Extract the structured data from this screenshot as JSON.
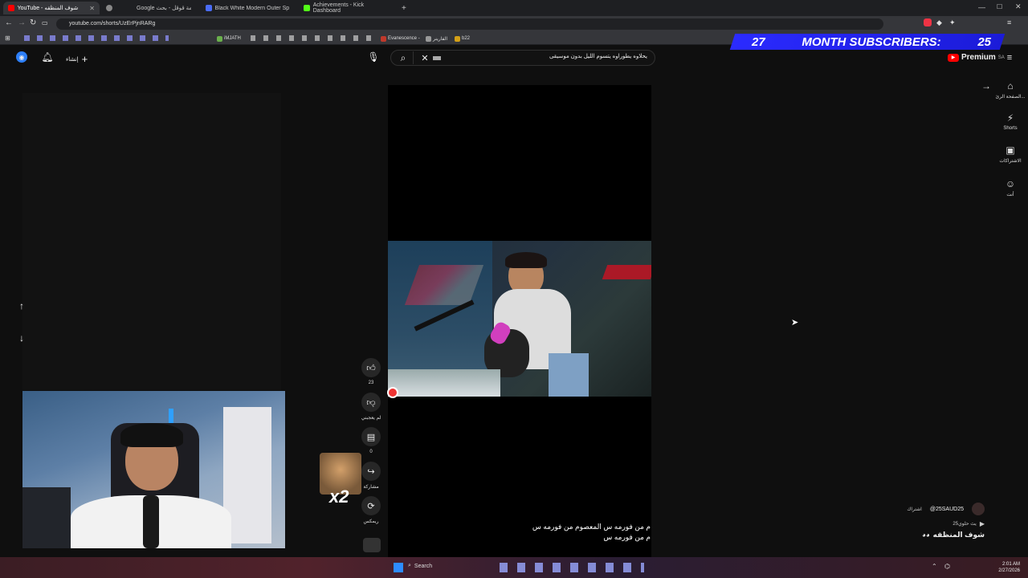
{
  "browser": {
    "tabs": [
      {
        "title": "YouTube - شوف المنظقه",
        "active": true
      },
      {
        "title": "",
        "active": false
      },
      {
        "title": "Google ترجمة قوقل - بحث",
        "active": false
      },
      {
        "title": "Black White Modern Outer Space Pr...",
        "active": false
      },
      {
        "title": "Achievements - Kick Dashboard",
        "active": false
      }
    ],
    "new_tab": "+",
    "url": "youtube.com/shorts/UzErPjnRARg",
    "bookmarks": [
      "iMJATH",
      "Evanescence -",
      "الفارينر",
      "b22"
    ]
  },
  "overlay": {
    "sub_count": "27",
    "sub_label": "MONTH SUBSCRIBERS:",
    "sub_goal": "25"
  },
  "youtube": {
    "logo_text": "Premium",
    "region": "SA",
    "create_label": "إنشاء",
    "search_value": "يحلاوه يطوراوه يتسوم الليل بدون موسيقى",
    "sidebar": [
      {
        "label": "الصفحة الرئ...",
        "icon": "home-icon"
      },
      {
        "label": "Shorts",
        "icon": "shorts-icon"
      },
      {
        "label": "الاشتراكات",
        "icon": "subscriptions-icon"
      },
      {
        "label": "أنت",
        "icon": "you-icon"
      }
    ],
    "actions": {
      "likes": "23",
      "dislike_label": "لم يعجبني",
      "comments": "0",
      "share_label": "مشاركة",
      "remix_label": "ريمكس"
    },
    "caption_line1": "م من فورمه س المعصوم من فورمه س",
    "caption_line2": "م من فورمه س",
    "channel": {
      "handle": "@25SAUD25",
      "subscribe": "اشتراك",
      "subtitle": "يث حلوي25",
      "title": "شوف المنظقه"
    },
    "overlay_x2": "x2"
  },
  "taskbar": {
    "search_label": "Search",
    "time": "2:01 AM",
    "date": "2/27/2026"
  },
  "colors": {
    "bg": "#0f0f0f",
    "overlay_blue": "#1b1bd8",
    "youtube_red": "#ff0000"
  }
}
